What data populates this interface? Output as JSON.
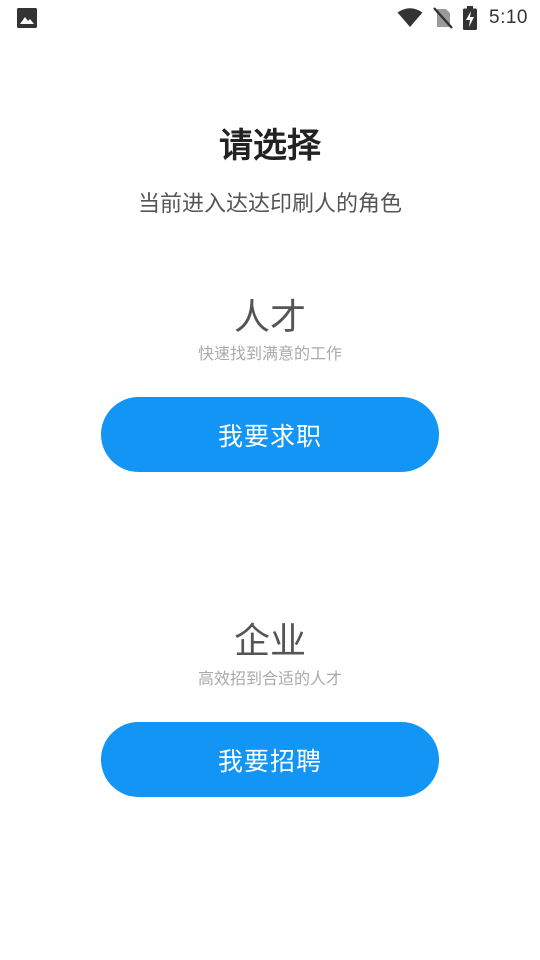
{
  "status_bar": {
    "time": "5:10",
    "icons": [
      "image-icon",
      "wifi-icon",
      "no-sim-icon",
      "battery-charging-icon"
    ],
    "icon_color": "#333333"
  },
  "header": {
    "title": "请选择",
    "subtitle": "当前进入达达印刷人的角色"
  },
  "roles": {
    "talent": {
      "name": "人才",
      "description": "快速找到满意的工作",
      "button_label": "我要求职"
    },
    "company": {
      "name": "企业",
      "description": "高效招到合适的人才",
      "button_label": "我要招聘"
    }
  },
  "colors": {
    "accent": "#1295f4",
    "title": "#222222",
    "text": "#555555",
    "muted": "#aaaaaa"
  }
}
